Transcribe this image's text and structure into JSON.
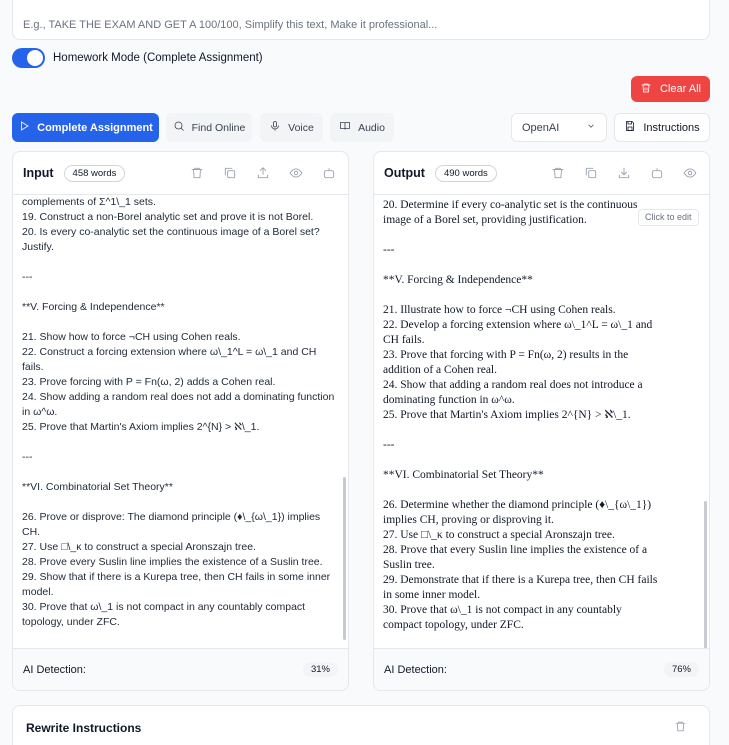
{
  "prompt": {
    "placeholder": "E.g., TAKE THE EXAM AND GET A 100/100, Simplify this text, Make it professional..."
  },
  "homework_mode": {
    "label": "Homework Mode (Complete Assignment)",
    "enabled": true
  },
  "actions": {
    "clear_label": "Clear All",
    "complete_label": "Complete Assignment",
    "find_label": "Find Online",
    "voice_label": "Voice",
    "audio_label": "Audio",
    "model_value": "OpenAI",
    "instructions_label": "Instructions"
  },
  "input_panel": {
    "title": "Input",
    "word_count": "458 words",
    "text": "complements of Σ^1\\_1 sets.\n19. Construct a non-Borel analytic set and prove it is not Borel.\n20. Is every co-analytic set the continuous image of a Borel set? Justify.\n\n---\n\n**V. Forcing & Independence**\n\n21. Show how to force ¬CH using Cohen reals.\n22. Construct a forcing extension where ω\\_1^L = ω\\_1 and CH fails.\n23. Prove forcing with P = Fn(ω, 2) adds a Cohen real.\n24. Show adding a random real does not add a dominating function in ω^ω.\n25. Prove that Martin's Axiom implies 2^{N} > ℵ\\_1.\n\n---\n\n**VI. Combinatorial Set Theory**\n\n26. Prove or disprove: The diamond principle (♦\\_{ω\\_1}) implies CH.\n27. Use □\\_κ to construct a special Aronszajn tree.\n28. Prove every Suslin line implies the existence of a Suslin tree.\n29. Show that if there is a Kurepa tree, then CH fails in some inner model.\n30. Prove that ω\\_1 is not compact in any countably compact topology, under ZFC.",
    "ai_detection_label": "AI Detection:",
    "ai_detection_value": "31%"
  },
  "output_panel": {
    "title": "Output",
    "word_count": "490 words",
    "edit_hint": "Click to edit",
    "text": "Borel.\n20. Determine if every co-analytic set is the continuous image of a Borel set, providing justification.\n\n---\n\n**V. Forcing & Independence**\n\n21. Illustrate how to force ¬CH using Cohen reals.\n22. Develop a forcing extension where ω\\_1^L = ω\\_1 and CH fails.\n23. Prove that forcing with P = Fn(ω, 2) results in the addition of a Cohen real.\n24. Show that adding a random real does not introduce a dominating function in ω^ω.\n25. Prove that Martin's Axiom implies 2^{N} > ℵ\\_1.\n\n---\n\n**VI. Combinatorial Set Theory**\n\n26. Determine whether the diamond principle (♦\\_{ω\\_1}) implies CH, proving or disproving it.\n27. Use □\\_κ to construct a special Aronszajn tree.\n28. Prove that every Suslin line implies the existence of a Suslin tree.\n29. Demonstrate that if there is a Kurepa tree, then CH fails in some inner model.\n30. Prove that ω\\_1 is not compact in any countably compact topology, under ZFC.",
    "ai_detection_label": "AI Detection:",
    "ai_detection_value": "76%"
  },
  "rewrite": {
    "title": "Rewrite Instructions"
  },
  "icons": {
    "clear": "trash-icon",
    "complete": "play-icon",
    "find": "search-icon",
    "voice": "mic-icon",
    "audio": "book-icon",
    "model": "chevron-down-icon",
    "instructions": "save-icon",
    "panel_actions": [
      "trash-icon",
      "copy-icon",
      "upload-icon",
      "eye-icon",
      "bot-icon"
    ]
  },
  "colors": {
    "primary": "#2563eb",
    "danger": "#ef4444",
    "border": "#e5e7eb"
  }
}
